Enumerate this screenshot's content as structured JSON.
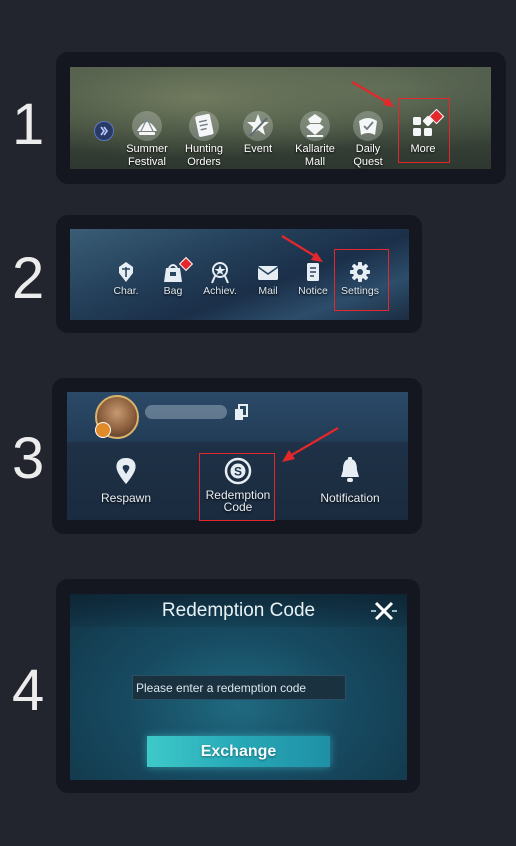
{
  "steps": [
    "1",
    "2",
    "3",
    "4"
  ],
  "step1": {
    "items": [
      {
        "label": "Summer\nFestival",
        "icon": "summer-festival-icon"
      },
      {
        "label": "Hunting\nOrders",
        "icon": "hunting-orders-icon"
      },
      {
        "label": "Event",
        "icon": "event-icon"
      },
      {
        "label": "Kallarite\nMall",
        "icon": "kallarite-mall-icon"
      },
      {
        "label": "Daily\nQuest",
        "icon": "daily-quest-icon"
      },
      {
        "label": "More",
        "icon": "more-grid-icon"
      }
    ]
  },
  "step2": {
    "items": [
      {
        "label": "Char.",
        "icon": "character-icon"
      },
      {
        "label": "Bag",
        "icon": "bag-icon"
      },
      {
        "label": "Achiev.",
        "icon": "achievement-icon"
      },
      {
        "label": "Mail",
        "icon": "mail-icon"
      },
      {
        "label": "Notice",
        "icon": "notice-icon"
      },
      {
        "label": "Settings",
        "icon": "settings-gear-icon"
      }
    ]
  },
  "step3": {
    "items": [
      {
        "label": "Respawn",
        "icon": "respawn-pin-icon"
      },
      {
        "label": "Redemption\nCode",
        "icon": "redemption-code-icon"
      },
      {
        "label": "Notification",
        "icon": "bell-icon"
      }
    ]
  },
  "step4": {
    "title": "Redemption Code",
    "input_placeholder": "Please enter a redemption code",
    "button_label": "Exchange"
  },
  "colors": {
    "highlight": "#e4272b",
    "background": "#23252e",
    "card": "#141720"
  }
}
